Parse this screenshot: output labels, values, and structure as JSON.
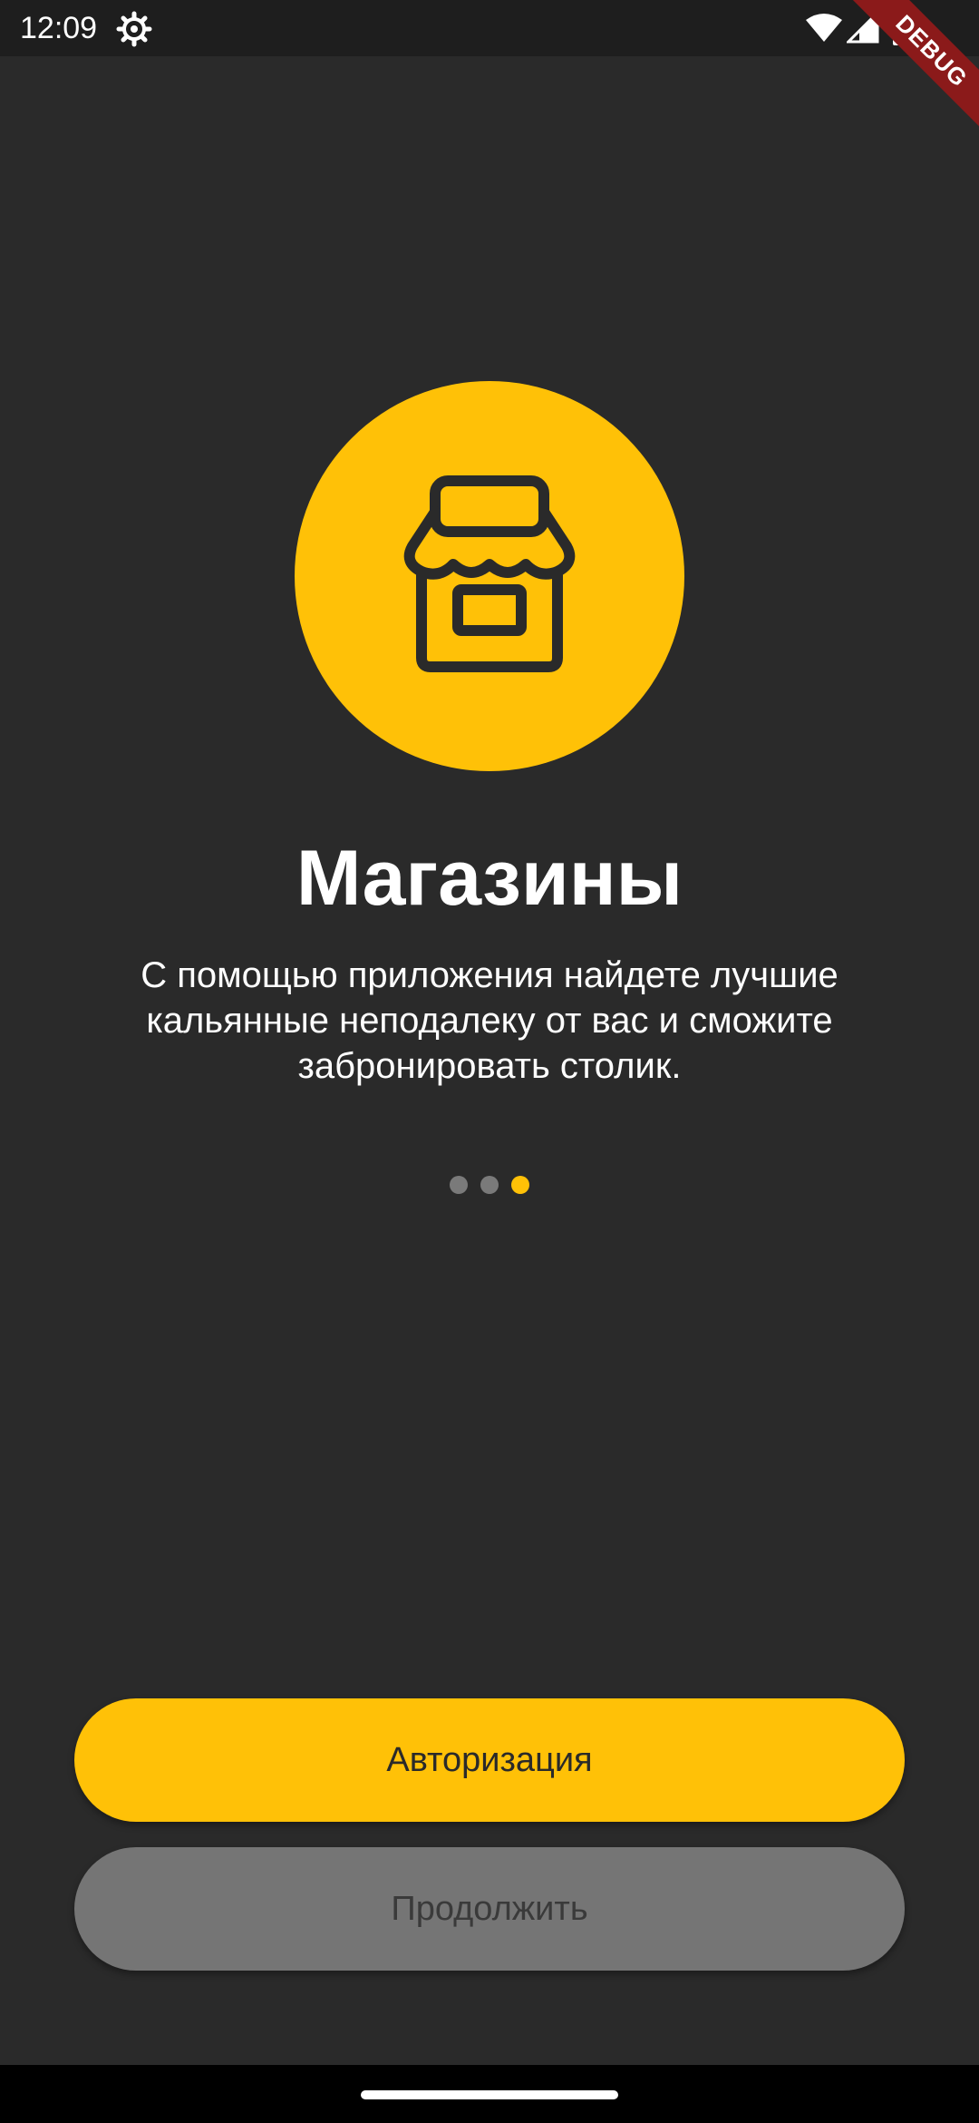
{
  "status_bar": {
    "time": "12:09",
    "icons": [
      "settings-gear-icon",
      "wifi-icon",
      "signal-icon",
      "battery-icon"
    ]
  },
  "debug_banner": "DEBUG",
  "onboarding": {
    "icon": "store-icon",
    "title": "Магазины",
    "description": "С помощью приложения найдете лучшие кальянные неподалеку от вас и сможите забронировать столик.",
    "pages_total": 3,
    "active_page": 3
  },
  "buttons": {
    "auth_label": "Авторизация",
    "continue_label": "Продолжить"
  },
  "colors": {
    "accent": "#ffc107",
    "background": "#2a2a2a",
    "secondary_button": "#757575",
    "inactive_dot": "#7a7a7a"
  }
}
